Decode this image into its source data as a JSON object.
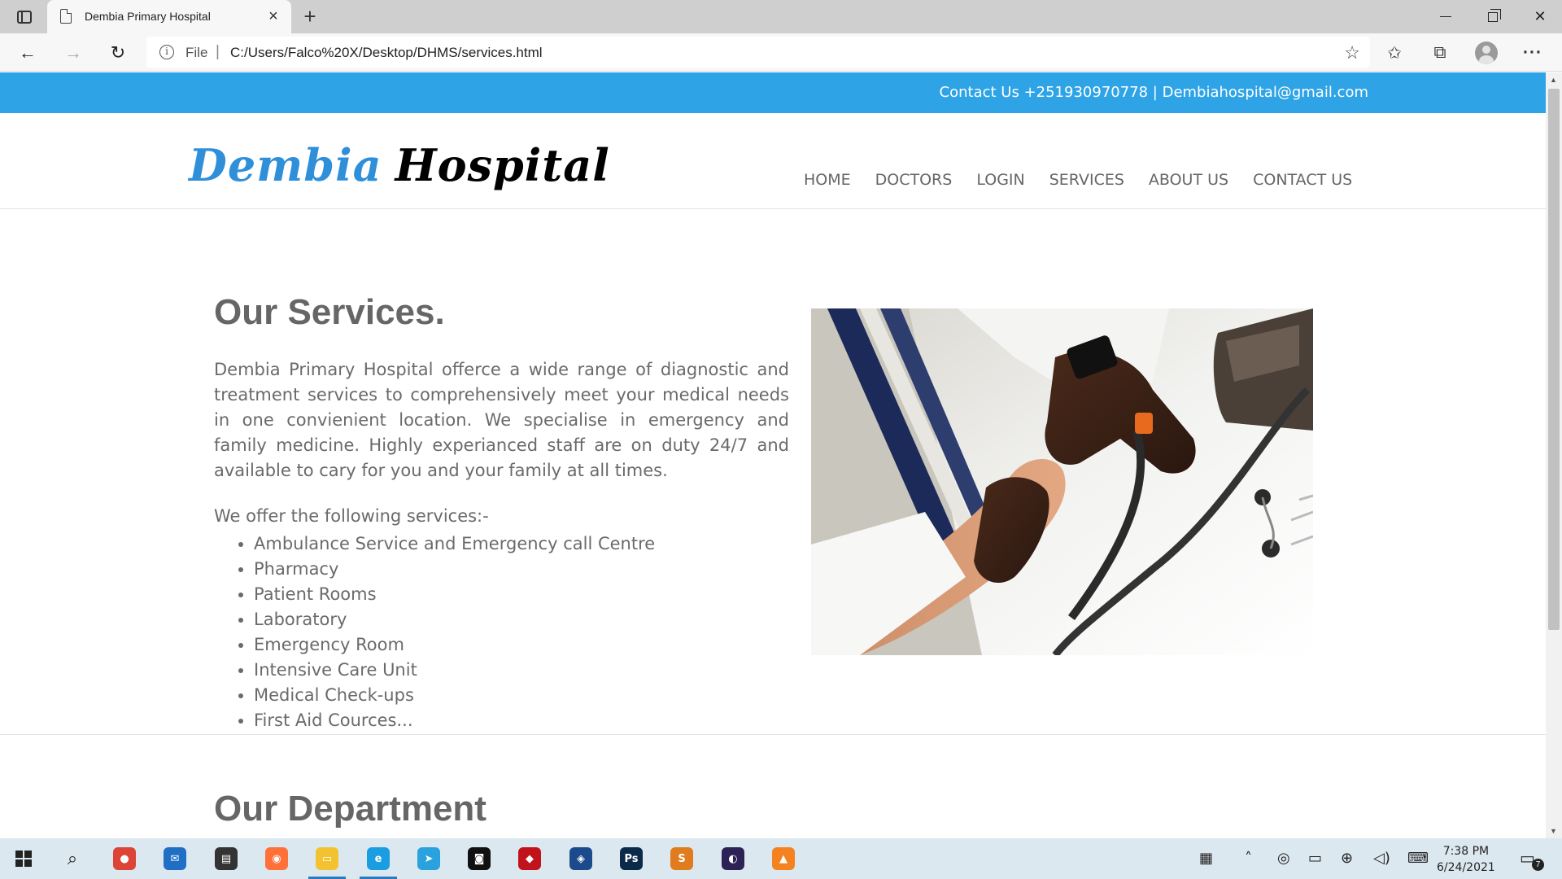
{
  "browser": {
    "tab_title": "Dembia Primary Hospital",
    "tab_close": "×",
    "new_tab": "+",
    "address_protocol": "File",
    "address_separator": "|",
    "address_url": "C:/Users/Falco%20X/Desktop/DHMS/services.html",
    "icons": {
      "back": "←",
      "forward": "→",
      "reload": "↻",
      "info": "i",
      "favorites_add": "☆",
      "favorites": "✩",
      "collections": "⧉",
      "more": "···"
    }
  },
  "site": {
    "topbar_contact": "Contact Us +251930970778 | Dembiahospital@gmail.com",
    "logo_part1": "Dembia",
    "logo_part2": "Hospital",
    "nav": [
      "HOME",
      "DOCTORS",
      "LOGIN",
      "SERVICES",
      "ABOUT US",
      "CONTACT US"
    ],
    "services_title": "Our Services.",
    "services_text": "Dembia Primary Hospital offerce a wide range of diagnostic and treatment services to comprehensively meet your medical needs in one convienient location. We specialise in emergency and family medicine. Highly experianced staff are on duty 24/7 and available to cary for you and your family at all times.",
    "offer_intro": "We offer the following services:-",
    "services": [
      "Ambulance Service and Emergency call Centre",
      "Pharmacy",
      "Patient Rooms",
      "Laboratory",
      "Emergency Room",
      "Intensive Care Unit",
      "Medical Check-ups",
      "First Aid Cources..."
    ],
    "department_title": "Our Department"
  },
  "taskbar": {
    "apps": [
      {
        "name": "chrome",
        "color": "#db4437",
        "glyph": "●"
      },
      {
        "name": "mail",
        "color": "#1f6fc5",
        "glyph": "✉"
      },
      {
        "name": "store",
        "color": "#333333",
        "glyph": "▤"
      },
      {
        "name": "firefox",
        "color": "#ff7139",
        "glyph": "◉"
      },
      {
        "name": "file-explorer",
        "color": "#f2c230",
        "glyph": "▭"
      },
      {
        "name": "edge",
        "color": "#1b9de2",
        "glyph": "e"
      },
      {
        "name": "telegram",
        "color": "#2aa2de",
        "glyph": "➤"
      },
      {
        "name": "screen-recorder",
        "color": "#111111",
        "glyph": "◙"
      },
      {
        "name": "shield-app",
        "color": "#c0131b",
        "glyph": "◆"
      },
      {
        "name": "security-app",
        "color": "#1b4b8c",
        "glyph": "◈"
      },
      {
        "name": "photoshop",
        "color": "#0b2a4a",
        "glyph": "Ps"
      },
      {
        "name": "sublime-text",
        "color": "#e07b1e",
        "glyph": "S"
      },
      {
        "name": "eclipse",
        "color": "#2c2255",
        "glyph": "◐"
      },
      {
        "name": "vlc",
        "color": "#f58220",
        "glyph": "▲"
      }
    ],
    "clock_time": "7:38 PM",
    "clock_date": "6/24/2021",
    "notification_count": "7"
  },
  "colors": {
    "topbar": "#2ea3e6",
    "logo_blue": "#2f8fd8",
    "text_gray": "#6a6a6a"
  }
}
